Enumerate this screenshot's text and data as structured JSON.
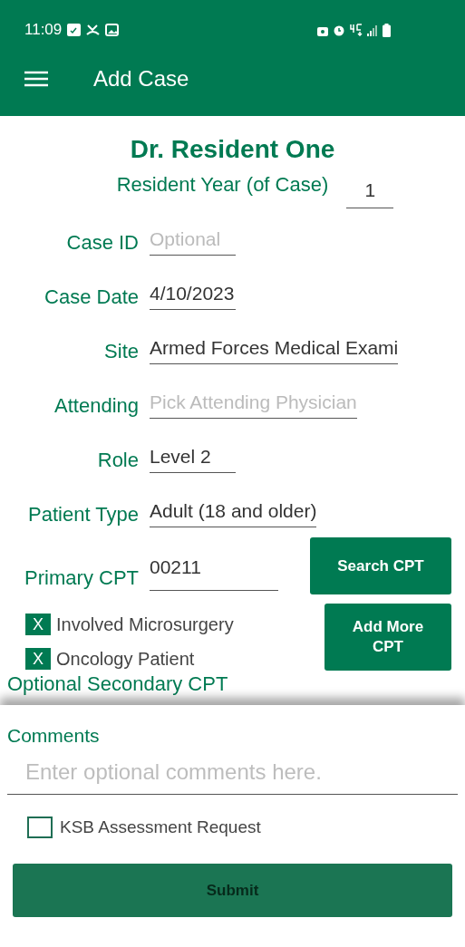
{
  "status_bar": {
    "time": "11:09"
  },
  "app_bar": {
    "title": "Add Case"
  },
  "form": {
    "doctor": "Dr. Resident One",
    "resident_year": {
      "label": "Resident Year (of Case)",
      "value": "1"
    },
    "fields": [
      {
        "label": "Case ID",
        "placeholder": "Optional"
      },
      {
        "label": "Case Date",
        "value": "4/10/2023"
      },
      {
        "label": "Site",
        "value": "Armed Forces Medical Exami"
      },
      {
        "label": "Attending",
        "placeholder": "Pick Attending Physician"
      },
      {
        "label": "Role",
        "value": "Level 2"
      },
      {
        "label": "Patient Type",
        "value": "Adult (18 and older)"
      },
      {
        "label": "Primary CPT",
        "value": "00211"
      }
    ],
    "search_button": "Search CPT",
    "checkboxes": [
      {
        "label": "Involved Microsurgery",
        "checked": true,
        "mark": "X"
      },
      {
        "label": "Oncology Patient",
        "checked": true,
        "mark": "X"
      }
    ],
    "add_more_button": "Add More CPT",
    "secondary_heading": "Optional Secondary CPT"
  },
  "sheet": {
    "comments_label": "Comments",
    "comments_placeholder": "Enter optional comments here.",
    "ksb": {
      "label": "KSB Assessment Request",
      "checked": false
    },
    "submit": {
      "label": "Submit",
      "disabled": true
    }
  }
}
